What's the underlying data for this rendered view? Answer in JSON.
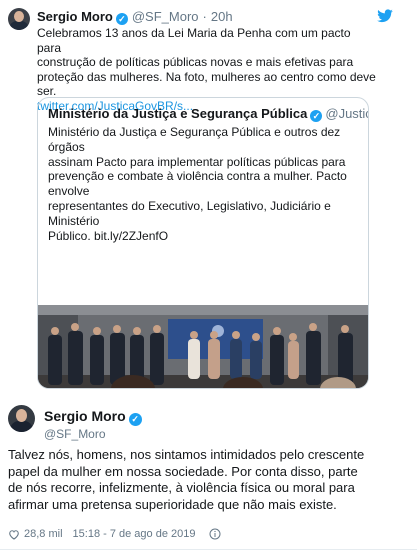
{
  "colors": {
    "accent": "#1da1f2",
    "link": "#1b95e0",
    "muted": "#657786",
    "text": "#14171a",
    "border": "#ccd6dd"
  },
  "parent_tweet": {
    "name": "Sergio Moro",
    "handle": "@SF_Moro",
    "time": "20h",
    "text_lines": [
      "Celebramos 13 anos da Lei Maria da Penha com um pacto para",
      "construção de políticas públicas novas e mais efetivas para",
      "proteção das mulheres. Na foto, mulheres ao centro como deve ser."
    ],
    "link": "twitter.com/JusticaGovBR/s..."
  },
  "quoted_tweet": {
    "name": "Ministério da Justiça e Segurança Pública",
    "handle": "@JusticaGo...",
    "text_lines": [
      "Ministério da Justiça e Segurança Pública e outros dez órgãos",
      "assinam Pacto para implementar políticas públicas para",
      "prevenção e combate à violência contra a mulher. Pacto envolve",
      "representantes do Executivo, Legislativo, Judiciário e Ministério",
      "Público. bit.ly/2ZJenfO"
    ]
  },
  "main_tweet": {
    "name": "Sergio Moro",
    "handle": "@SF_Moro",
    "text_lines": [
      "Talvez nós, homens, nos sintamos intimidados pelo crescente",
      "papel da mulher em nossa sociedade. Por conta disso, parte",
      "de nós recorre, infelizmente, à violência física ou moral para",
      "afirmar uma pretensa superioridade que não mais existe."
    ],
    "likes": "28,8 mil",
    "timestamp": "15:18 - 7 de ago de 2019"
  },
  "icons": {
    "verified": "verified-badge-icon",
    "bird": "twitter-bird-icon",
    "heart": "heart-icon",
    "info": "info-icon"
  }
}
